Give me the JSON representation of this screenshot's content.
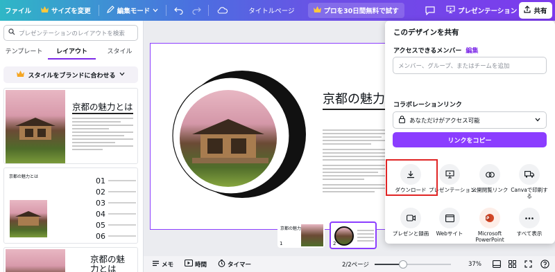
{
  "topbar": {
    "file": "ファイル",
    "resize": "サイズを変更",
    "edit_mode": "編集モード",
    "title": "タイトルページ",
    "promo": "プロを30日間無料で試す",
    "present": "プレゼンテーション",
    "share": "共有"
  },
  "sidebar": {
    "search_placeholder": "プレゼンテーションのレイアウトを検索",
    "tabs": [
      "テンプレート",
      "レイアウト",
      "スタイル"
    ],
    "brand_button": "スタイルをブランドに合わせる",
    "thumb1_title": "京都の魅力とは",
    "thumb2_title": "京都の魅力とは",
    "thumb2_numbers": [
      "01",
      "02",
      "03",
      "04",
      "05",
      "06"
    ],
    "thumb3_title_line1": "京都の魅",
    "thumb3_title_line2": "力とは"
  },
  "slide": {
    "title": "京都の魅力とは"
  },
  "pages": {
    "p1_title": "京都の魅力",
    "p1_num": "1",
    "p2_num": "2"
  },
  "bottombar": {
    "memo": "メモ",
    "timer_label": "時間",
    "timer": "タイマー",
    "page": "2/2ページ",
    "zoom": "37%"
  },
  "share_panel": {
    "title": "このデザインを共有",
    "access_label": "アクセスできるメンバー",
    "edit": "編集",
    "input_placeholder": "メンバー、グループ、またはチームを追加",
    "collab_label": "コラボレーションリンク",
    "access_value": "あなただけがアクセス可能",
    "copy_link": "リンクをコピー",
    "options_row1": [
      "ダウンロード",
      "プレゼンテーション",
      "公開閲覧リンク",
      "Canvaで印刷する"
    ],
    "options_row2": [
      "プレゼンと録画",
      "Webサイト",
      "Microsoft PowerPoint",
      "すべて表示"
    ]
  },
  "colors": {
    "accent": "#8b3dff",
    "highlight": "#e02424"
  }
}
